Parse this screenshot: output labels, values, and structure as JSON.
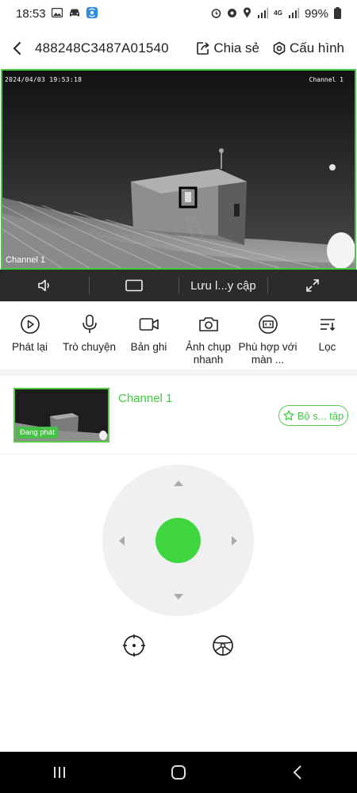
{
  "status_bar": {
    "time": "18:53",
    "battery": "99%",
    "network": "4G"
  },
  "header": {
    "title": "488248C3487A01540",
    "share_label": "Chia sẻ",
    "config_label": "Cấu hình",
    "icons": [
      "back-arrow-icon",
      "share-icon",
      "settings-icon"
    ]
  },
  "video": {
    "timestamp": "2024/04/03 19:53:18",
    "channel_osd": "Channel 1",
    "bottom_label": "Channel 1"
  },
  "control_bar": {
    "save_label": "Lưu l...y cập",
    "icons": [
      "speaker-icon",
      "aspect-ratio-icon",
      "fullscreen-icon"
    ]
  },
  "toolbar": {
    "items": [
      {
        "label": "Phát lại",
        "icon": "playback-icon"
      },
      {
        "label": "Trò chuyện",
        "icon": "microphone-icon"
      },
      {
        "label": "Bản ghi",
        "icon": "video-record-icon"
      },
      {
        "label": "Ảnh chụp nhanh",
        "icon": "camera-icon"
      },
      {
        "label": "Phù hợp với màn ...",
        "icon": "fit-screen-icon"
      },
      {
        "label": "Lọc",
        "icon": "filter-icon"
      }
    ]
  },
  "channel": {
    "name": "Channel 1",
    "badge": "Đang phát",
    "favorite_label": "Bộ s... tập"
  },
  "colors": {
    "accent": "#3fd63f",
    "control_bar_bg": "#2b2b2b",
    "ptz_bg": "#f0f0f0"
  }
}
